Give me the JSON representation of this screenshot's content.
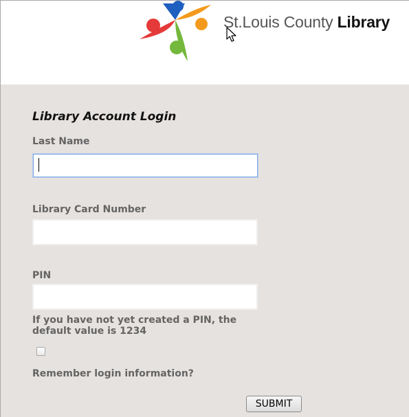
{
  "header": {
    "logo_text_regular": "St.Louis County",
    "logo_text_bold": "Library",
    "logo_colors": {
      "red": "#e53a3a",
      "blue": "#1f5fbf",
      "orange": "#f39a1e",
      "green": "#74b83c"
    }
  },
  "form": {
    "title": "Library Account Login",
    "last_name_label": "Last Name",
    "last_name_value": "",
    "card_number_label": "Library Card Number",
    "card_number_value": "",
    "pin_label": "PIN",
    "pin_value": "",
    "pin_hint": "If you have not yet created a PIN, the default value is 1234",
    "remember_label": "Remember login information?",
    "remember_checked": false,
    "submit_label": "SUBMIT"
  },
  "colors": {
    "panel_background": "#e6e2df",
    "label_text": "#646464",
    "focus_border": "#7ea6e0"
  }
}
